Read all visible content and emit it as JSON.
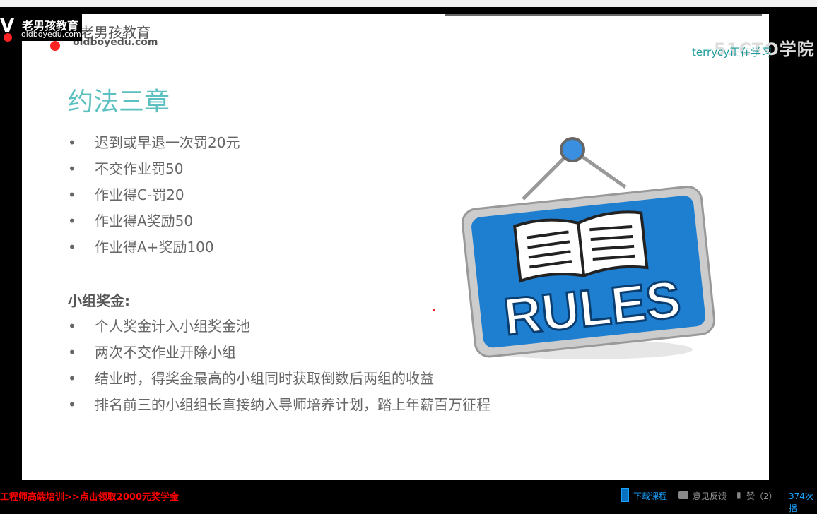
{
  "logo": {
    "name_cn": "老男孩教育",
    "domain": "oldboyedu.com"
  },
  "watermark": "51CTO学院",
  "learning_status": "terrycy正在学习",
  "slide": {
    "title": "约法三章",
    "rules": [
      "迟到或早退一次罚20元",
      "不交作业罚50",
      "作业得C-罚20",
      "作业得A奖励50",
      "作业得A+奖励100"
    ],
    "group_heading": "小组奖金:",
    "group_rules": [
      "个人奖金计入小组奖金池",
      "两次不交作业开除小组",
      "结业时，得奖金最高的小组同时获取倒数后两组的收益",
      "排名前三的小组组长直接纳入导师培养计划，踏上年薪百万征程"
    ],
    "sign_text": "RULES"
  },
  "bottom": {
    "promo": "工程师高端培训>>点击领取2000元奖学金",
    "download": "下载课程",
    "feedback": "意见反馈",
    "like": "赞（2）",
    "views": "374次播"
  },
  "colors": {
    "title": "#5cc0c0",
    "promo": "#ff0000",
    "link": "#1aa3ff",
    "sign": "#1e7fd0"
  }
}
